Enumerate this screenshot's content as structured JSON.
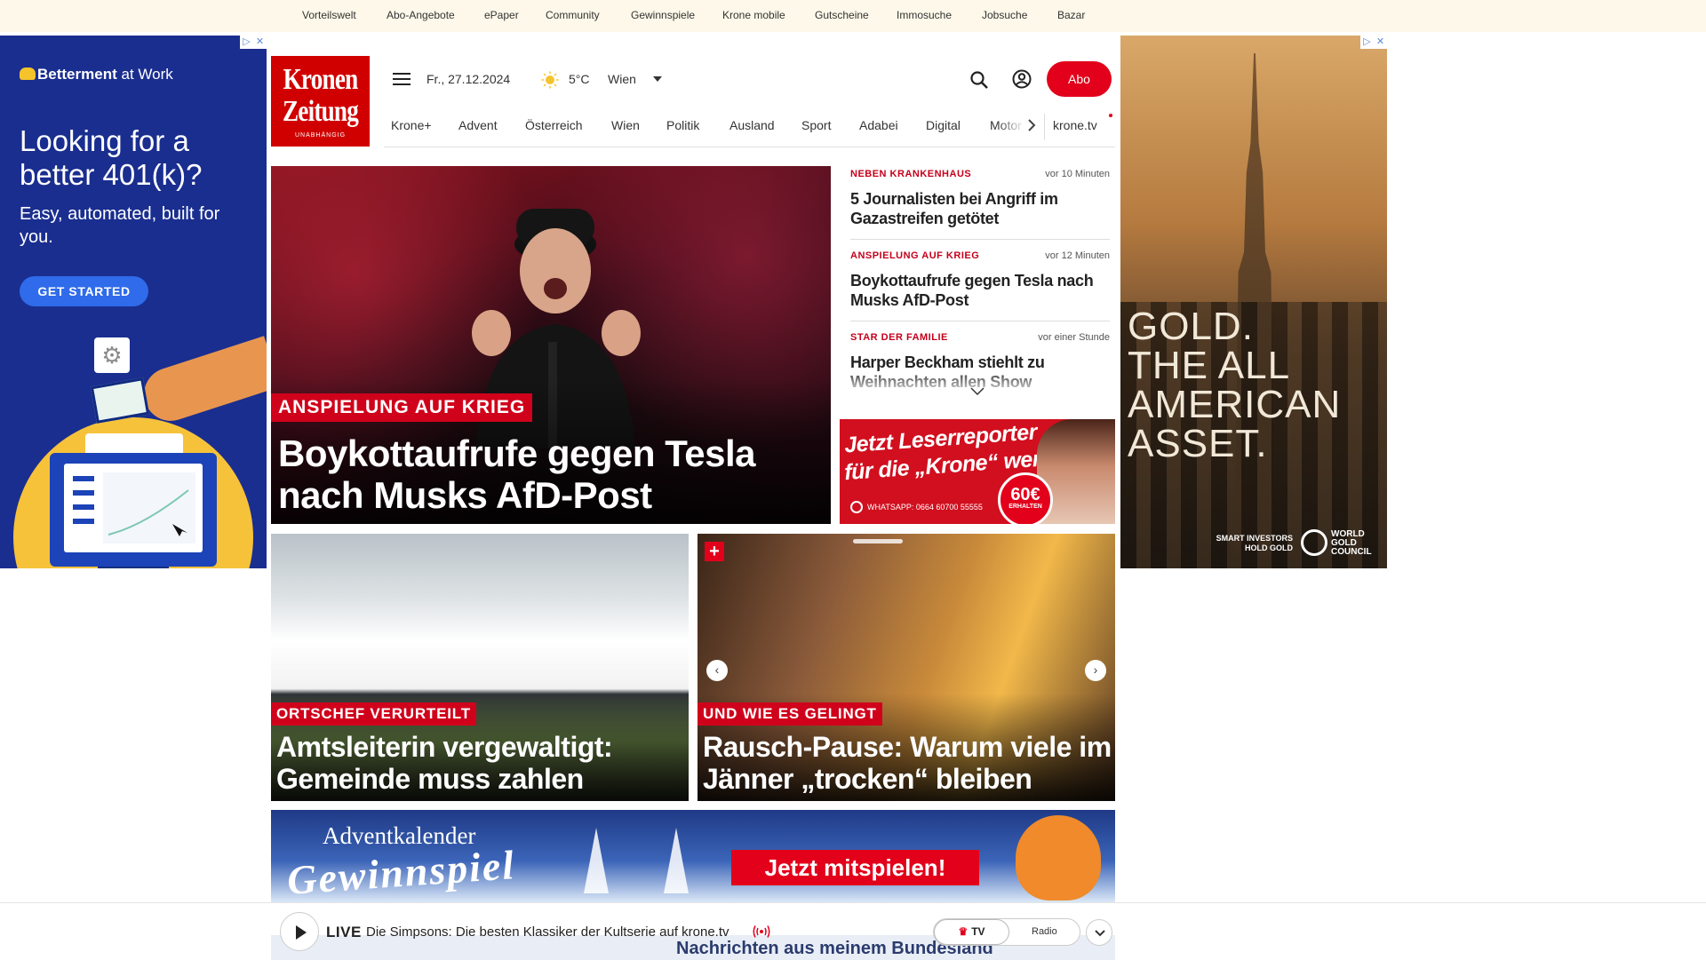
{
  "topbar": {
    "links": [
      "Vorteilswelt",
      "Abo-Angebote",
      "ePaper",
      "Community",
      "Gewinnspiele",
      "Krone mobile",
      "Gutscheine",
      "Immosuche",
      "Jobsuche",
      "Bazar"
    ]
  },
  "ad_left": {
    "brand": "Betterment",
    "brand_suffix": "at Work",
    "headline": "Looking for a better 401(k)?",
    "subline": "Easy, automated, built for you.",
    "cta": "GET STARTED",
    "colors": {
      "background": "#1a2e8f",
      "button": "#2f6bea",
      "accent": "#f6c23a"
    }
  },
  "logo": {
    "line1": "Kronen",
    "line2": "Zeitung",
    "tagline": "UNABHÄNGIG",
    "color": "#d10000"
  },
  "header": {
    "date": "Fr., 27.12.2024",
    "weather_icon": "sun-icon",
    "temperature": "5°C",
    "city": "Wien",
    "abo_label": "Abo",
    "accent": "#e2001a"
  },
  "nav": {
    "items": [
      "Krone+",
      "Advent",
      "Österreich",
      "Wien",
      "Politik",
      "Ausland",
      "Sport",
      "Adabei",
      "Digital",
      "Motor"
    ],
    "tv_link": "krone.tv"
  },
  "hero": {
    "kicker": "ANSPIELUNG AUF KRIEG",
    "title": "Boykottaufrufe gegen Tesla nach Musks AfD-Post"
  },
  "news": [
    {
      "kicker": "NEBEN KRANKENHAUS",
      "time": "vor 10 Minuten",
      "title": "5 Journalisten bei Angriff im Gazastreifen getötet"
    },
    {
      "kicker": "ANSPIELUNG AUF KRIEG",
      "time": "vor 12 Minuten",
      "title": "Boykottaufrufe gegen Tesla nach Musks AfD-Post"
    },
    {
      "kicker": "STAR DER FAMILIE",
      "time": "vor einer Stunde",
      "title": "Harper Beckham stiehlt zu Weihnachten allen Show"
    }
  ],
  "reporter_ad": {
    "line1": "Jetzt Leserreporter",
    "line2": "für die „Krone“ werden",
    "whatsapp": "WHATSAPP: 0664 60700 55555",
    "badge_amount": "60€",
    "badge_label": "ERHALTEN"
  },
  "cards": [
    {
      "kicker": "ORTSCHEF VERURTEILT",
      "title": "Amtsleiterin vergewaltigt: Gemeinde muss zahlen"
    },
    {
      "kicker": "UND WIE ES GELINGT",
      "title": "Rausch-Pause: Warum viele im Jänner „trocken“ bleiben",
      "badge": "+"
    }
  ],
  "advent": {
    "line1": "Adventkalender",
    "line2": "Gewinnspiel",
    "cta": "Jetzt mitspielen!"
  },
  "player": {
    "live_label": "LIVE",
    "title": "Die Simpsons: Die besten Klassiker der Kultserie auf krone.tv",
    "tv_label": "TV",
    "radio_label": "Radio",
    "behind_text": "Nachrichten aus meinem Bundesland"
  },
  "ad_right": {
    "headline": [
      "GOLD.",
      "THE ALL",
      "AMERICAN",
      "ASSET."
    ],
    "smart": "SMART INVESTORS HOLD GOLD",
    "org": "WORLD GOLD COUNCIL"
  }
}
